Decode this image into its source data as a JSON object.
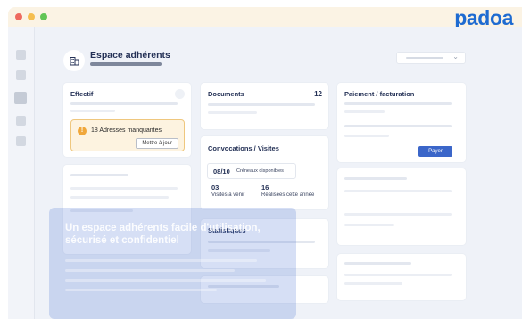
{
  "app": {
    "logo": "padoa"
  },
  "titlebar": {
    "dot_colors": [
      "#ee6a5f",
      "#f5be4f",
      "#62c555"
    ]
  },
  "header": {
    "title": "Espace adhérents"
  },
  "cards": {
    "effectif": {
      "title": "Effectif"
    },
    "alert": {
      "text": "18 Adresses manquantes",
      "button_label": "Mettre à jour",
      "icon": "!"
    },
    "documents": {
      "title": "Documents",
      "count": "12"
    },
    "convocations": {
      "title": "Convocations / Visites",
      "slots": {
        "value": "08/10",
        "label": "Créneaux disponibles"
      },
      "upcoming": {
        "value": "03",
        "label": "Visites à venir"
      },
      "done": {
        "value": "16",
        "label": "Réalisées cette année"
      }
    },
    "statistiques": {
      "title": "Statistiques"
    },
    "paiement": {
      "title": "Paiement / facturation",
      "button_label": "Payer"
    }
  },
  "overlay": {
    "title": "Un espace adhérents facile d'utilisation, sécurisé et confidentiel"
  },
  "colors": {
    "accent": "#1e6bd1",
    "warning": "#f0a73a",
    "button": "#3b66c9"
  }
}
